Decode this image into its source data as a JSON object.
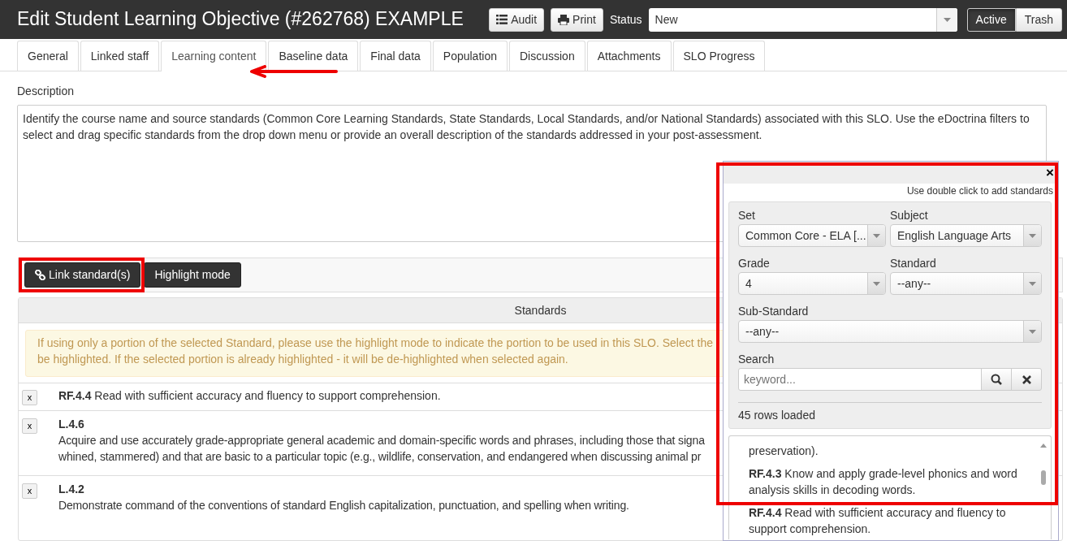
{
  "header": {
    "title": "Edit Student Learning Objective (#262768) EXAMPLE",
    "buttons": [
      {
        "kind": "list",
        "label": "Audit"
      },
      {
        "kind": "print",
        "label": "Print"
      }
    ],
    "status_label": "Status",
    "status_value": "New",
    "toggle": [
      {
        "label": "Active",
        "selected": true
      },
      {
        "label": "Trash",
        "selected": false
      }
    ]
  },
  "tabs": [
    {
      "label": "General",
      "selected": false
    },
    {
      "label": "Linked staff",
      "selected": false
    },
    {
      "label": "Learning content",
      "selected": true
    },
    {
      "label": "Baseline data",
      "selected": false
    },
    {
      "label": "Final data",
      "selected": false
    },
    {
      "label": "Population",
      "selected": false
    },
    {
      "label": "Discussion",
      "selected": false
    },
    {
      "label": "Attachments",
      "selected": false
    },
    {
      "label": "SLO Progress",
      "selected": false
    }
  ],
  "description": {
    "label": "Description",
    "value": "Identify the course name and source standards (Common Core Learning Standards, State Standards, Local Standards, and/or National Standards) associated with this SLO.  Use the eDoctrina filters to select and drag specific standards from the drop down menu or provide an overall description of the standards addressed in your post-assessment."
  },
  "toolbar": [
    {
      "kind": "link",
      "label": "Link standard(s)"
    },
    {
      "kind": "plain",
      "label": "Highlight mode"
    }
  ],
  "standards": {
    "heading": "Standards",
    "alert_lines": [
      "If using only a portion of the selected Standard, please use the highlight mode to indicate the portion to be used in this SLO. Select the",
      "be highlighted. If the selected portion is already highlighted - it will be de-highlighted when selected again."
    ],
    "rows": [
      {
        "kind": "inline",
        "remove": "x",
        "code": "RF.4.4",
        "lines": [
          "Read with sufficient accuracy and fluency to support comprehension."
        ]
      },
      {
        "kind": "block",
        "remove": "x",
        "code": "L.4.6",
        "lines": [
          "Acquire and use accurately grade-appropriate general academic and domain-specific words and phrases, including those that signa",
          "whined, stammered) and that are basic to a particular topic (e.g., wildlife, conservation, and endangered when discussing animal pr"
        ]
      },
      {
        "kind": "block",
        "remove": "x",
        "code": "L.4.2",
        "lines": [
          "Demonstrate command of the conventions of standard English capitalization, punctuation, and spelling when writing."
        ]
      }
    ]
  },
  "popup": {
    "close": "×",
    "hint": "Use double click to add standards",
    "filters": [
      {
        "label": "Set",
        "value": "Common Core - ELA [..."
      },
      {
        "label": "Subject",
        "value": "English Language Arts"
      },
      {
        "label": "Grade",
        "value": "4"
      },
      {
        "label": "Standard",
        "value": "--any--"
      },
      {
        "label": "Sub-Standard",
        "value": "--any--"
      }
    ],
    "search": {
      "label": "Search",
      "placeholder": "keyword..."
    },
    "count": "45 rows loaded",
    "items": [
      {
        "text": "preservation)."
      },
      {
        "code": "RF.4.3",
        "text": "Know and apply grade-level phonics and word analysis skills in decoding words."
      },
      {
        "code": "RF.4.4",
        "text": "Read with sufficient accuracy and fluency to support comprehension."
      }
    ]
  },
  "annotations": [
    {
      "kind": "arrow"
    },
    {
      "kind": "frame-button"
    },
    {
      "kind": "frame-popup"
    }
  ]
}
